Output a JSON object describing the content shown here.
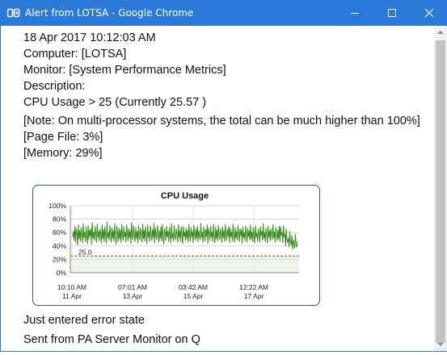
{
  "window": {
    "title": "Alert from LOTSA - Google Chrome",
    "app_icon_text": "0̈",
    "accent_color": "#2b79d8"
  },
  "alert": {
    "timestamp": "18 Apr 2017 10:12:03 AM",
    "computer": "Computer: [LOTSA]",
    "monitor": "Monitor: [System Performance Metrics]",
    "description_label": "Description:",
    "condition": "CPU Usage > 25 (Currently 25.57 )",
    "note": "[Note: On multi-processor systems, the total can be much higher than 100%]",
    "page_file": "[Page File: 3%]",
    "memory": "[Memory: 29%]",
    "state": "Just entered error state",
    "sent_from": "Sent from PA Server Monitor on Q"
  },
  "chart_data": {
    "type": "line",
    "title": "CPU Usage",
    "ylim": [
      0,
      100
    ],
    "y_ticks": [
      "0%",
      "20%",
      "40%",
      "60%",
      "80%",
      "100%"
    ],
    "x_ticks": [
      {
        "time": "10:10 AM",
        "date": "11 Apr"
      },
      {
        "time": "07:01 AM",
        "date": "13 Apr"
      },
      {
        "time": "03:42 AM",
        "date": "15 Apr"
      },
      {
        "time": "12:22 AM",
        "date": "17 Apr"
      }
    ],
    "threshold": 25,
    "threshold_label": "25.0",
    "threshold_color": "#c0392b",
    "series_color": "#3a8a1e",
    "grid": true,
    "series": [
      {
        "values": [
          53,
          62,
          48,
          70,
          45,
          66,
          58,
          41,
          72,
          50,
          63,
          47,
          68,
          55,
          44,
          74,
          52,
          60,
          46,
          69,
          57,
          43,
          71,
          49,
          64,
          54,
          67,
          42,
          75,
          51,
          61,
          48,
          70,
          56,
          45,
          73,
          53,
          62,
          47,
          66,
          58,
          44,
          72,
          50,
          65,
          46,
          69,
          55,
          43,
          76,
          52,
          60,
          48,
          71,
          57,
          45,
          68,
          51,
          63,
          47,
          74,
          54,
          42,
          70,
          59,
          46,
          67,
          50,
          64,
          44,
          73,
          56,
          48,
          69,
          53,
          61,
          45,
          72,
          58,
          47,
          66,
          52,
          63,
          43,
          75,
          55,
          49,
          70,
          57,
          46,
          68,
          51,
          62,
          44,
          71,
          54,
          48,
          67,
          59,
          45,
          73,
          50,
          64,
          47,
          69,
          56,
          43,
          72,
          53,
          61,
          46,
          70,
          58,
          48,
          65,
          52,
          74,
          44,
          67,
          55,
          49,
          71,
          57,
          45,
          63,
          51,
          69,
          47,
          73,
          54,
          42,
          66,
          60,
          48,
          70,
          53,
          62,
          46,
          68,
          56,
          44,
          74,
          51,
          59,
          47,
          71,
          55,
          49,
          65,
          58,
          45,
          72,
          52,
          63,
          46,
          69,
          57,
          43,
          70,
          54,
          61,
          48,
          67,
          50,
          64,
          45,
          73,
          56,
          47,
          68,
          53,
          62,
          44,
          71,
          58,
          48,
          66,
          51,
          70,
          46,
          63,
          55,
          49,
          74,
          52,
          60,
          45,
          69,
          57,
          47,
          65,
          54,
          72,
          43,
          67,
          59,
          48,
          70,
          53,
          61,
          46,
          73,
          56,
          44,
          68,
          50,
          64,
          47,
          71,
          55,
          49,
          66,
          58,
          45,
          69,
          52,
          63,
          46,
          72,
          57,
          48,
          65,
          54,
          70,
          44,
          67,
          53,
          61,
          47,
          73,
          56,
          45,
          68,
          51,
          62,
          48,
          71,
          59,
          46,
          66,
          55,
          64,
          43,
          69,
          52,
          60,
          47,
          70,
          57,
          45,
          67,
          54,
          63,
          48,
          72,
          50,
          61,
          46,
          68,
          56,
          44,
          71,
          53,
          59,
          47,
          65,
          58,
          45,
          69,
          55,
          62,
          48,
          74,
          51,
          60,
          46,
          67,
          57,
          44,
          70,
          53,
          63,
          47,
          66,
          56,
          49,
          72,
          52,
          61,
          45,
          68,
          58,
          48,
          64,
          50,
          70,
          46,
          69,
          55,
          60,
          44,
          71,
          53,
          58,
          40,
          66,
          50,
          45,
          52,
          38,
          62,
          46,
          41,
          56,
          35,
          49,
          44,
          36,
          58,
          42,
          38,
          47
        ]
      }
    ]
  }
}
